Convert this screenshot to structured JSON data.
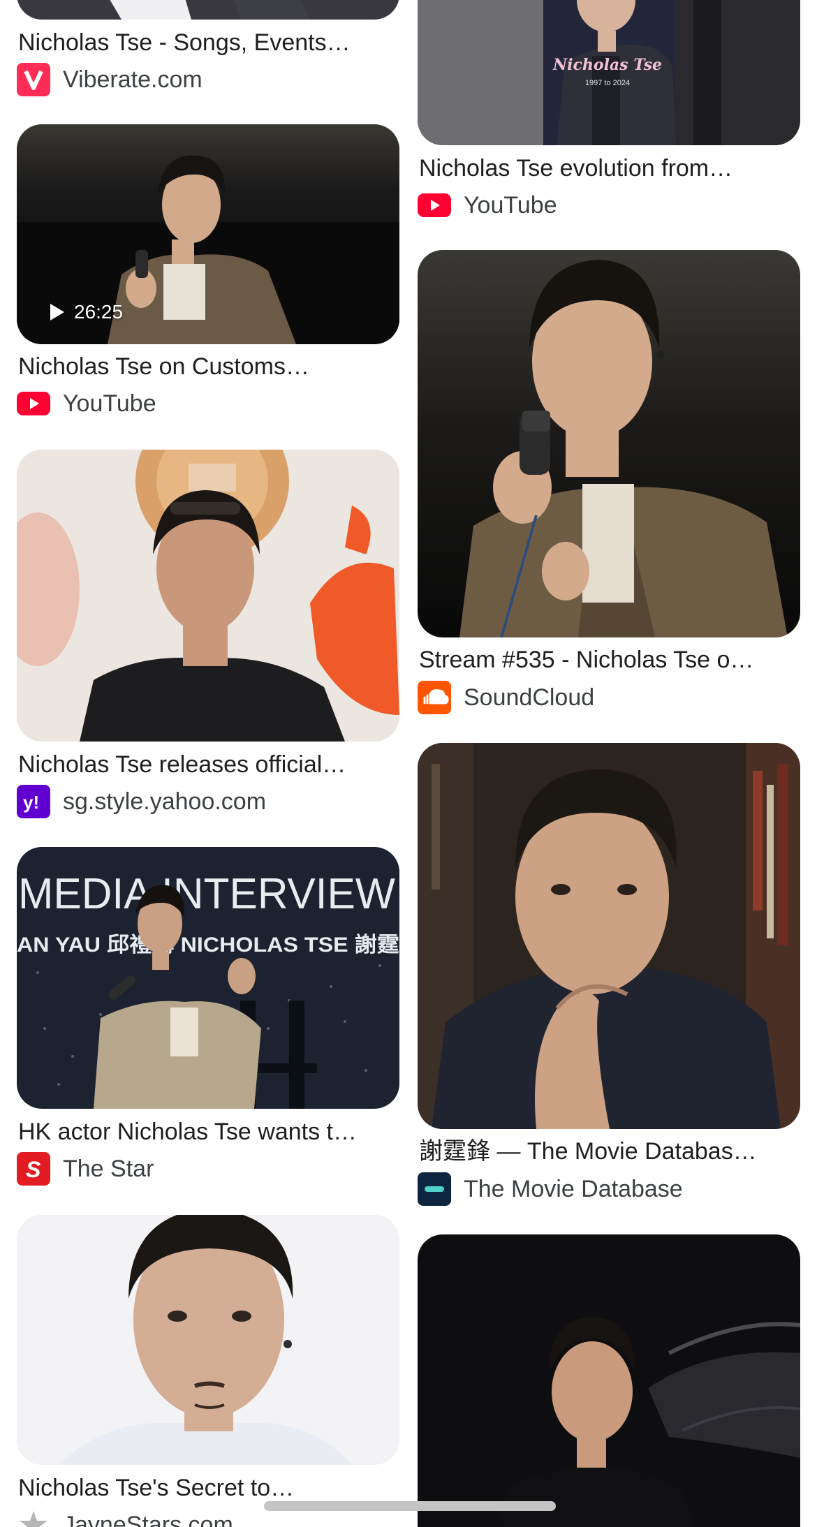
{
  "results": {
    "left": [
      {
        "title": "Nicholas Tse - Songs, Events…",
        "source": "Viberate.com",
        "favicon": "viberate-icon",
        "color": "#ff2d55"
      },
      {
        "title": "Nicholas Tse on Customs…",
        "source": "YouTube",
        "favicon": "youtube-icon",
        "color": "#ff0033",
        "duration": "26:25"
      },
      {
        "title": "Nicholas Tse releases official…",
        "source": "sg.style.yahoo.com",
        "favicon": "yahoo-icon",
        "color": "#6001d2"
      },
      {
        "title": "HK actor Nicholas Tse wants t…",
        "source": "The Star",
        "favicon": "the-star-icon",
        "color": "#e31b23"
      },
      {
        "title": "Nicholas Tse's Secret to…",
        "source": "JayneStars.com",
        "favicon": "jaynestars-icon",
        "color": "#9e9e9e"
      }
    ],
    "right": [
      {
        "title": "Nicholas Tse evolution from…",
        "source": "YouTube",
        "favicon": "youtube-icon",
        "color": "#ff0033",
        "overlay_name": "Nicholas Tse",
        "overlay_years": "1997 to 2024"
      },
      {
        "title": "Stream #535 - Nicholas Tse o…",
        "source": "SoundCloud",
        "favicon": "soundcloud-icon",
        "color": "#ff5500"
      },
      {
        "title": "謝霆鋒 — The Movie Databas…",
        "source": "The Movie Database",
        "favicon": "tmdb-icon",
        "color": "#0d253f"
      },
      {
        "title": "",
        "source": "",
        "favicon": ""
      }
    ]
  },
  "image_text": {
    "interview_backdrop": "MEDIA INTERVIEW",
    "interview_names": "AN YAU 邱禮濤  NICHOLAS TSE 謝霆"
  }
}
